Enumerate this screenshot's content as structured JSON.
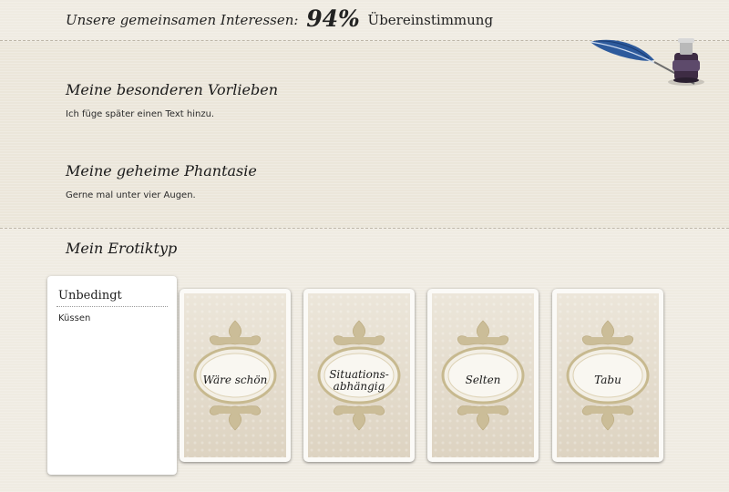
{
  "header": {
    "prefix": "Unsere gemeinsamen Interessen:",
    "percent": "94%",
    "suffix": "Übereinstimmung"
  },
  "sections": [
    {
      "title": "Meine besonderen Vorlieben",
      "text": "Ich füge später einen Text hinzu."
    },
    {
      "title": "Meine geheime Phantasie",
      "text": "Gerne mal unter vier Augen."
    }
  ],
  "erotiktyp": {
    "title": "Mein Erotiktyp",
    "panel": {
      "heading": "Unbedingt",
      "items": [
        "Küssen"
      ]
    },
    "cards": [
      {
        "label": "Wäre schön"
      },
      {
        "label_line1": "Situations-",
        "label_line2": "abhängig"
      },
      {
        "label": "Selten"
      },
      {
        "label": "Tabu"
      }
    ]
  },
  "decoration": {
    "icon": "quill-inkwell-icon"
  },
  "colors": {
    "background": "#efebe2",
    "band": "#ebe6da",
    "card_ornament": "#cbbd98"
  }
}
